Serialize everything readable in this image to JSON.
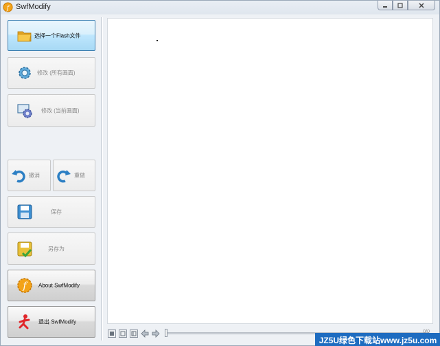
{
  "window": {
    "title": "SwfModify",
    "minimize_icon": "minimize-icon",
    "maximize_icon": "maximize-icon",
    "close_icon": "close-icon"
  },
  "sidebar": {
    "select_file": "选择一个Flash文件",
    "modify_all": "修改 (所有画面)",
    "modify_current": "修改 (当前画面)",
    "undo": "撤消",
    "redo": "重做",
    "save": "保存",
    "save_as": "另存为",
    "about": "About SwfModify",
    "exit": "退出 SwfModify"
  },
  "player": {
    "status_end": "0/0"
  },
  "watermark": "JZ5U绿色下载站www.jz5u.com",
  "colors": {
    "primary_button": "#bee6fd",
    "primary_border": "#3c7fb1",
    "watermark_bg": "#1e6cc0"
  }
}
